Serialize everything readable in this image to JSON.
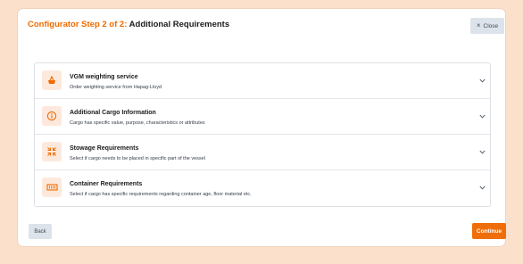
{
  "header": {
    "step": "Configurator Step 2 of 2:",
    "name": "Additional Requirements",
    "close_icon": "close-icon",
    "close_label": "Close"
  },
  "requirements": [
    {
      "title": "VGM weighting service",
      "description": "Order weighting service from Hapag-Lloyd",
      "icon": "scale-icon"
    },
    {
      "title": "Additional Cargo Information",
      "description": "Cargo has specific value, purpose, characteristics or attributes",
      "icon": "info-icon"
    },
    {
      "title": "Stowage Requirements",
      "description": "Select if cargo needs to be placed in specific part of the vessel",
      "icon": "stowage-icon"
    },
    {
      "title": "Container Requirements",
      "description": "Select if cargo has specific requirements regarding container age, floor material etc.",
      "icon": "container-icon"
    }
  ],
  "footer": {
    "back_label": "Back",
    "continue_label": "Continue"
  },
  "colors": {
    "accent": "#ef6b00",
    "icon_bg": "#fde9dc",
    "page_bg": "#fbe0cc",
    "secondary_button": "#dde3ea"
  }
}
